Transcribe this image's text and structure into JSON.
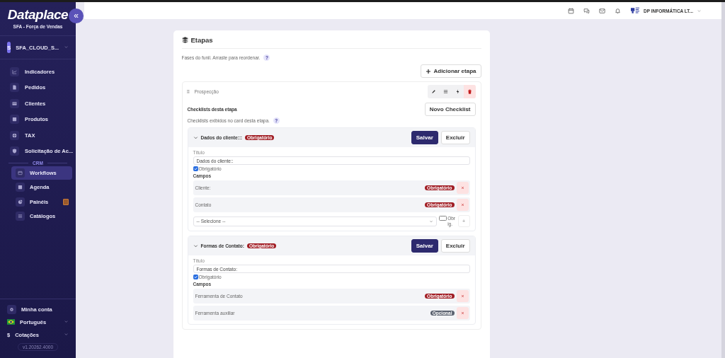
{
  "sidebar": {
    "logo": "Dataplace",
    "subtitle": "SFA - Força de Vendas",
    "collapse": "«",
    "account": {
      "initial": "S",
      "name": "SFA_CLOUD_S..."
    },
    "items": [
      {
        "label": "Indicadores",
        "selected": false
      },
      {
        "label": "Pedidos",
        "selected": false
      },
      {
        "label": "Clientes",
        "selected": false
      },
      {
        "label": "Produtos",
        "selected": false
      },
      {
        "label": "TAX",
        "selected": false
      },
      {
        "label": "Solicitação de Ac...",
        "selected": false
      }
    ],
    "section": "CRM",
    "crm_items": [
      {
        "label": "Workflows",
        "selected": true,
        "flag": false
      },
      {
        "label": "Agenda",
        "selected": false,
        "flag": false
      },
      {
        "label": "Painéis",
        "selected": false,
        "flag": true
      },
      {
        "label": "Catálogos",
        "selected": false,
        "flag": false
      }
    ],
    "footer": {
      "account": "Minha conta",
      "language": "Português",
      "currency_symbol": "$",
      "currency": "Cotações",
      "version": "v1.20262.4000"
    }
  },
  "header": {
    "company": "DP INFORMÁTICA LT..."
  },
  "stages": {
    "title": "Etapas",
    "description": "Fases do funil. Arraste para reordenar.",
    "help": "?",
    "add_button": "Adicionar etapa",
    "stage": {
      "name": "Prospecção",
      "checklists_title": "Checklists desta etapa",
      "new_checklist": "Novo Checklist",
      "checklists_description": "Checklists exibidos no card desta etapa.",
      "help": "?",
      "checklists": [
        {
          "title": "Dados do cliente:::",
          "badge": "Obrigatório",
          "expanded": true,
          "save": "Salvar",
          "delete": "Excluir",
          "title_label": "Título",
          "title_value": "Dados do cliente::",
          "required": true,
          "required_label": "Obrigatório",
          "fields_label": "Campos",
          "fields": [
            {
              "name": "Cliente:",
              "required": true,
              "badge": "Obrigatório"
            },
            {
              "name": "Contato",
              "required": true,
              "badge": "Obrigatório"
            }
          ],
          "add_field": {
            "placeholder": "-- Selecione --",
            "required": false,
            "required_label": "Obrig.",
            "add": "+"
          }
        },
        {
          "title": "Formas de Contato:",
          "badge": "Obrigatório",
          "expanded": true,
          "save": "Salvar",
          "delete": "Excluir",
          "title_label": "Título",
          "title_value": "Formas de Contato:",
          "required": true,
          "required_label": "Obrigatório",
          "fields_label": "Campos",
          "fields": [
            {
              "name": "Ferramenta de Contato",
              "required": true,
              "badge": "Obrigatório"
            },
            {
              "name": "Ferramenta auxiliar",
              "required": false,
              "badge": "Opcional"
            }
          ]
        }
      ]
    }
  }
}
